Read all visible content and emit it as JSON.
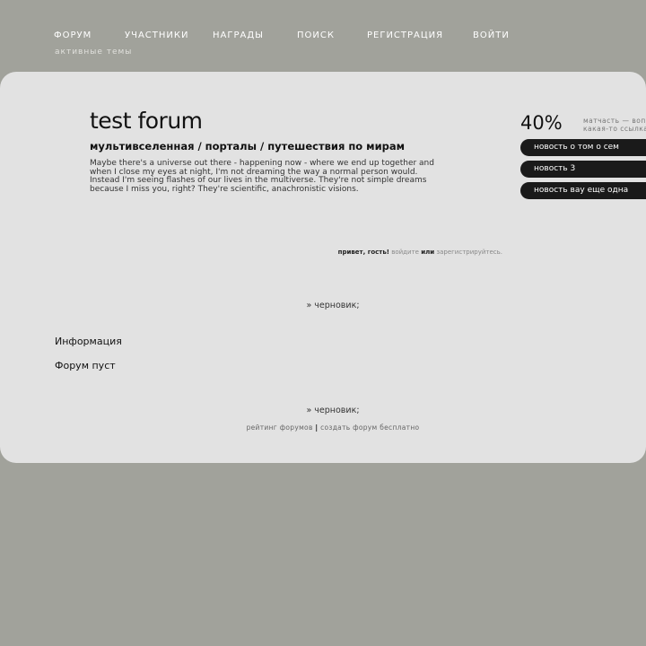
{
  "nav": {
    "items": [
      {
        "label": "ФОРУМ"
      },
      {
        "label": "УЧАСТНИКИ"
      },
      {
        "label": "НАГРАДЫ"
      },
      {
        "label": "ПОИСК"
      },
      {
        "label": "РЕГИСТРАЦИЯ"
      },
      {
        "label": "ВОЙТИ"
      }
    ],
    "sub_label": "активные темы"
  },
  "header": {
    "title": "test forum",
    "subtitle": "мультивселенная / порталы / путешествия по мирам",
    "description": "Maybe there's a universe out there - happening now - where we end up together and when I close my eyes at night, I'm not dreaming the way a normal person would. Instead I'm seeing flashes of our lives in the multiverse. They're not simple dreams because I miss you, right? They're scientific, anachronistic visions."
  },
  "sidebar": {
    "percent": "40%",
    "note_line1": "матчасть — вопр",
    "note_line2": "какая-то ссылка",
    "news": [
      {
        "label": "новость о том о сем"
      },
      {
        "label": "новость 3"
      },
      {
        "label": "новость вау еще одна"
      }
    ]
  },
  "greeting": {
    "hello": "привет, гость!",
    "login": "войдите",
    "or": "или",
    "register": "зарегистрируйтесь."
  },
  "content": {
    "draft_top": "» черновик;",
    "info_heading": "Информация",
    "empty_text": "Форум пуст",
    "draft_bottom": "» черновик;"
  },
  "footer": {
    "rating": "рейтинг форумов",
    "separator": "|",
    "create": "создать форум бесплатно"
  },
  "colors": {
    "background": "#a1a29b",
    "card": "#e2e2e2",
    "pill": "#1a1a1a"
  }
}
